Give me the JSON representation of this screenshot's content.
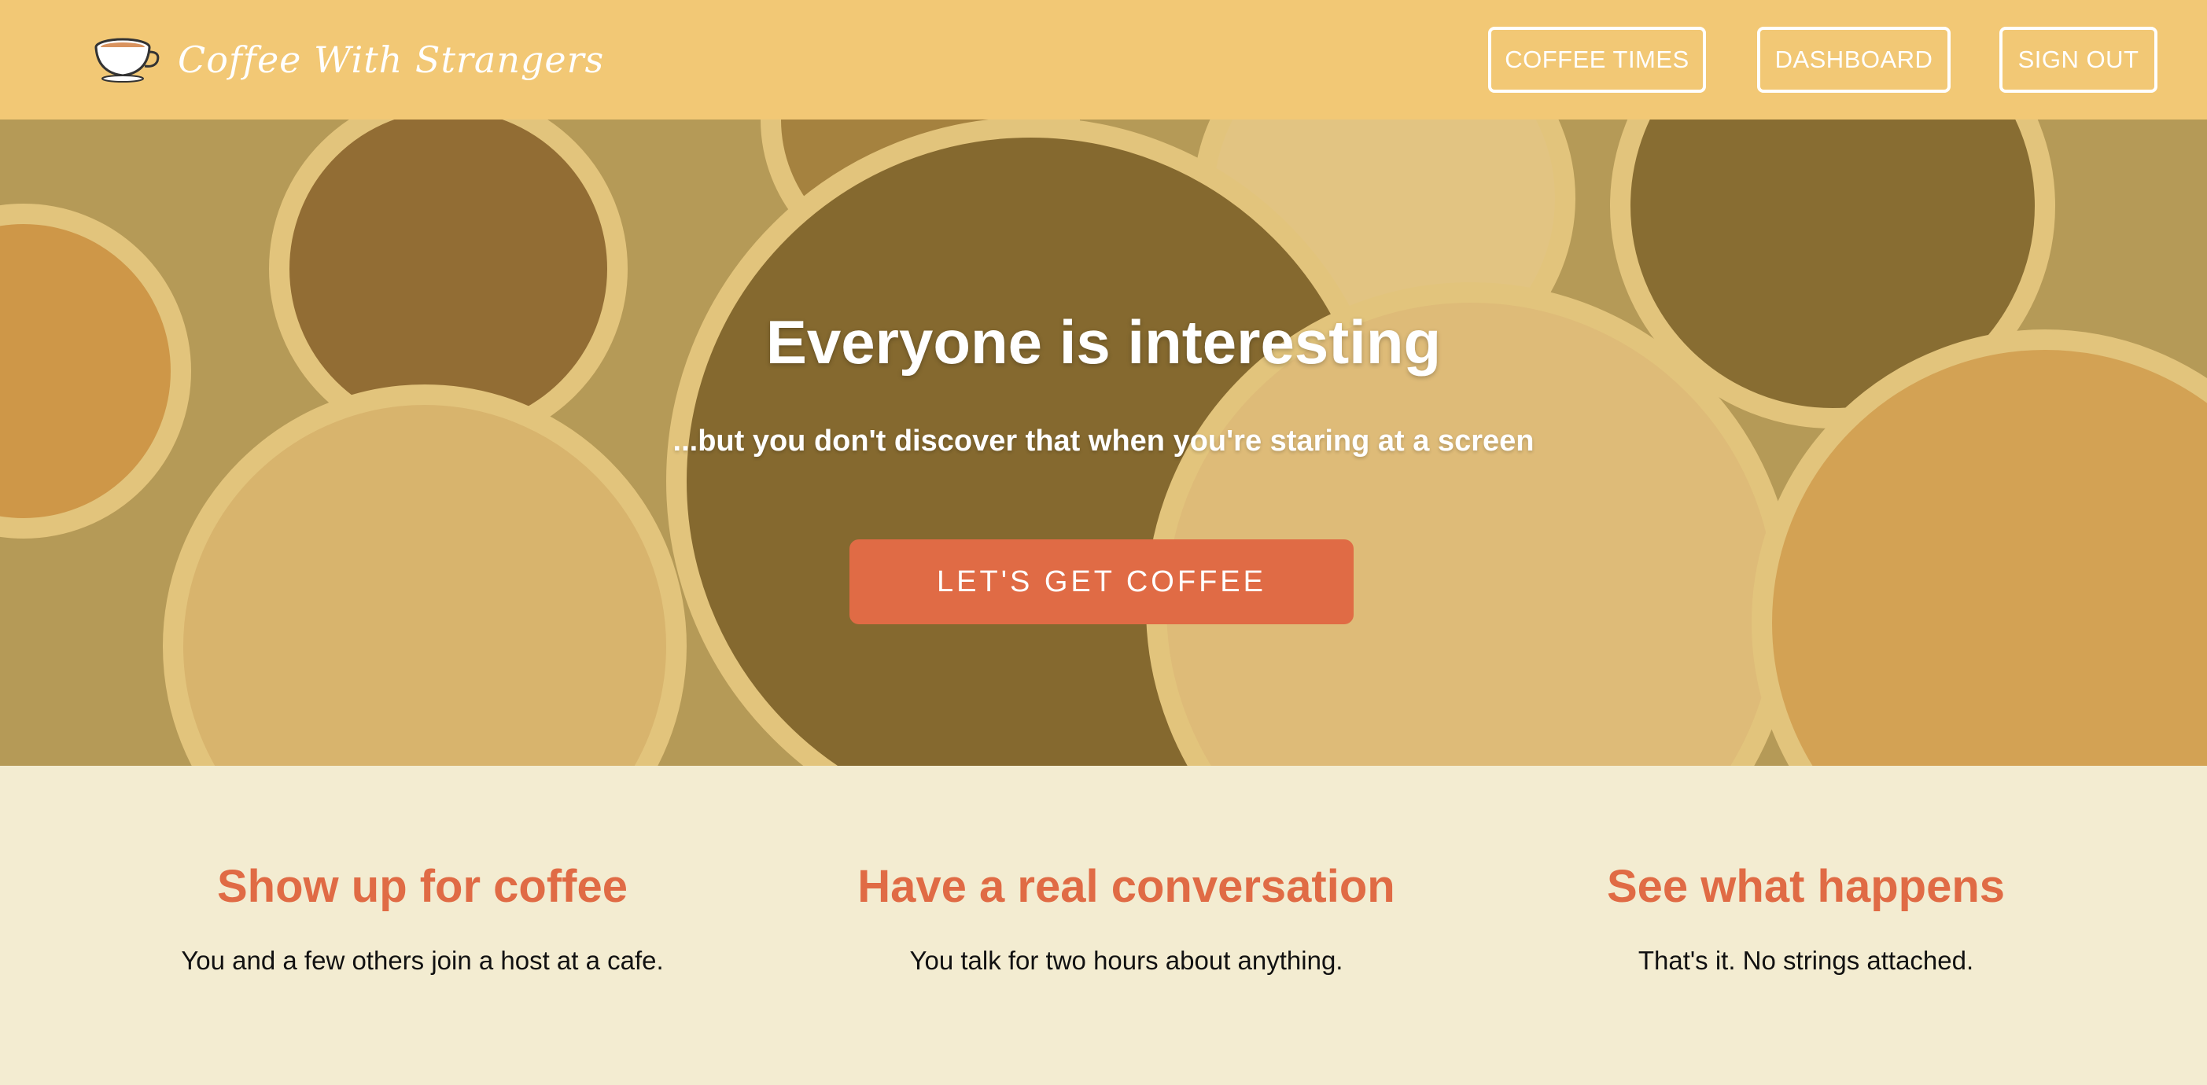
{
  "brand": {
    "name": "Coffee With Strangers",
    "logo_icon": "coffee-cup-icon"
  },
  "nav": {
    "coffee_times": "COFFEE TIMES",
    "dashboard": "DASHBOARD",
    "sign_out": "SIGN OUT"
  },
  "hero": {
    "title": "Everyone is interesting",
    "subtitle": "...but you don't discover that when you're staring at a screen",
    "cta_label": "LET'S GET COFFEE"
  },
  "features": [
    {
      "title": "Show up for coffee",
      "text": "You and a few others join a host at a cafe."
    },
    {
      "title": "Have a real conversation",
      "text": "You talk for two hours about anything."
    },
    {
      "title": "See what happens",
      "text": "That's it. No strings attached."
    }
  ],
  "colors": {
    "navbar": "#f2c875",
    "accent": "#e06b45",
    "page_background": "#f3ecd1"
  }
}
